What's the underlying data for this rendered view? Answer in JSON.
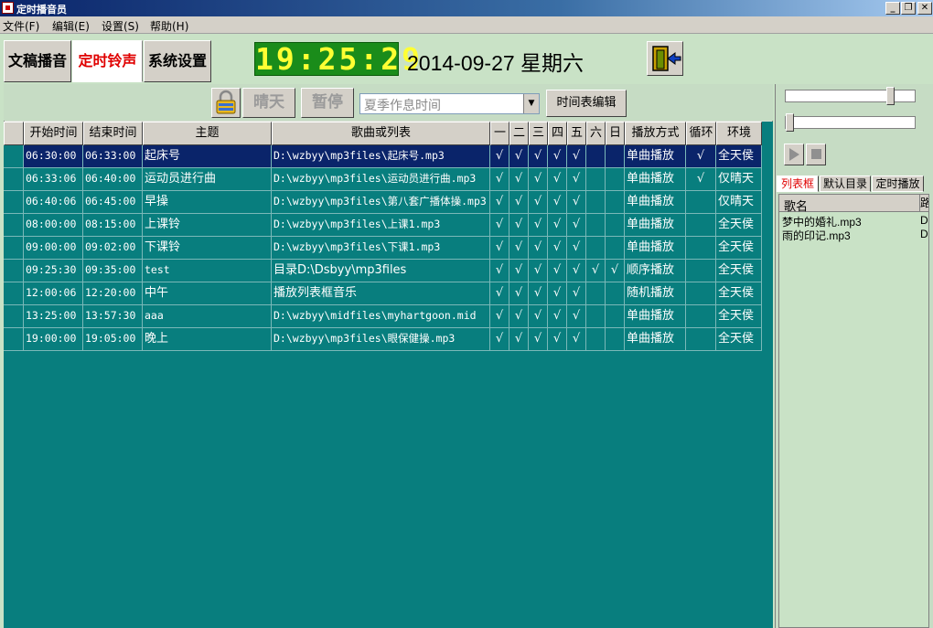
{
  "window": {
    "title": "定时播音员",
    "controls": [
      "_",
      "❐",
      "✕"
    ]
  },
  "menu": [
    "文件(F)",
    "编辑(E)",
    "设置(S)",
    "帮助(H)"
  ],
  "tabs": [
    "文稿播音",
    "定时铃声",
    "系统设置"
  ],
  "active_tab": "定时铃声",
  "clock": "19:25:29",
  "date": "2014-09-27 星期六",
  "toolbar": {
    "sunny_label": "晴天",
    "pause_label": "暂停",
    "schedule_select": "夏季作息时间",
    "edit_label": "时间表编辑"
  },
  "table": {
    "columns": [
      "开始时间",
      "结束时间",
      "主题",
      "歌曲或列表",
      "一",
      "二",
      "三",
      "四",
      "五",
      "六",
      "日",
      "播放方式",
      "循环",
      "环境"
    ],
    "rows": [
      [
        "06:30:00",
        "06:33:00",
        "起床号",
        "D:\\wzbyy\\mp3files\\起床号.mp3",
        "√",
        "√",
        "√",
        "√",
        "√",
        "",
        "",
        "单曲播放",
        "√",
        "全天侯"
      ],
      [
        "06:33:06",
        "06:40:00",
        "运动员进行曲",
        "D:\\wzbyy\\mp3files\\运动员进行曲.mp3",
        "√",
        "√",
        "√",
        "√",
        "√",
        "",
        "",
        "单曲播放",
        "√",
        "仅晴天"
      ],
      [
        "06:40:06",
        "06:45:00",
        "早操",
        "D:\\wzbyy\\mp3files\\第八套广播体操.mp3",
        "√",
        "√",
        "√",
        "√",
        "√",
        "",
        "",
        "单曲播放",
        "",
        "仅晴天"
      ],
      [
        "08:00:00",
        "08:15:00",
        "上课铃",
        "D:\\wzbyy\\mp3files\\上课1.mp3",
        "√",
        "√",
        "√",
        "√",
        "√",
        "",
        "",
        "单曲播放",
        "",
        "全天侯"
      ],
      [
        "09:00:00",
        "09:02:00",
        "下课铃",
        "D:\\wzbyy\\mp3files\\下课1.mp3",
        "√",
        "√",
        "√",
        "√",
        "√",
        "",
        "",
        "单曲播放",
        "",
        "全天侯"
      ],
      [
        "09:25:30",
        "09:35:00",
        "test",
        "目录D:\\Dsbyy\\mp3files",
        "√",
        "√",
        "√",
        "√",
        "√",
        "√",
        "√",
        "顺序播放",
        "",
        "全天侯"
      ],
      [
        "12:00:06",
        "12:20:00",
        "中午",
        "播放列表框音乐",
        "√",
        "√",
        "√",
        "√",
        "√",
        "",
        "",
        "随机播放",
        "",
        "全天侯"
      ],
      [
        "13:25:00",
        "13:57:30",
        "aaa",
        "D:\\wzbyy\\midfiles\\myhartgoon.mid",
        "√",
        "√",
        "√",
        "√",
        "√",
        "",
        "",
        "单曲播放",
        "",
        "全天侯"
      ],
      [
        "19:00:00",
        "19:05:00",
        "晚上",
        "D:\\wzbyy\\mp3files\\眼保健操.mp3",
        "√",
        "√",
        "√",
        "√",
        "√",
        "",
        "",
        "单曲播放",
        "",
        "全天侯"
      ]
    ],
    "selected_row": 0
  },
  "right_panel": {
    "tabs": [
      "列表框",
      "默认目录",
      "定时播放"
    ],
    "active_tab": "列表框",
    "list_header": "歌名",
    "list_header2": "路",
    "songs": [
      "梦中的婚礼.mp3",
      "雨的印记.mp3"
    ],
    "song_col2": [
      "D",
      "D"
    ],
    "volume_level": 0.8,
    "progress_level": 0.0
  },
  "colors": {
    "grid_bg": "#087e7e",
    "selected_row": "#0a246a",
    "active_tab_text": "#e00000",
    "clock_bg": "#1a8c1a",
    "clock_digits": "#ffff33"
  }
}
